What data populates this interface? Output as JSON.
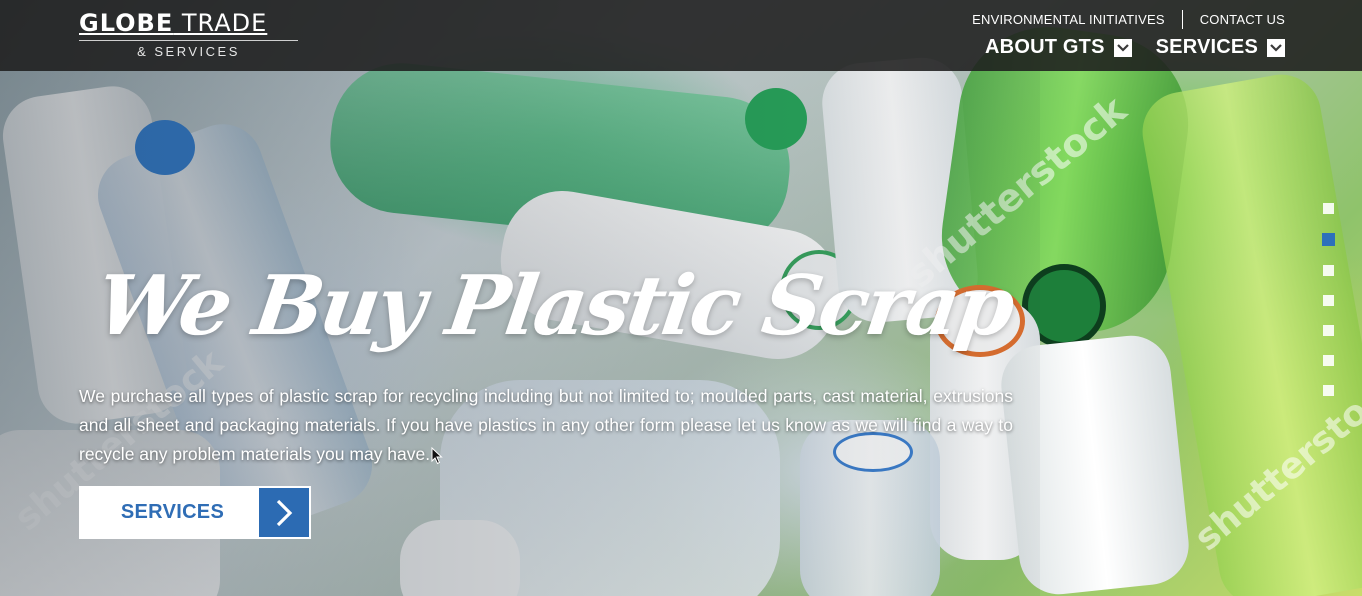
{
  "header": {
    "logo": {
      "main_bold": "GLOBE",
      "main_rest": " TRADE",
      "sub": "& SERVICES"
    },
    "utility_links": [
      "ENVIRONMENTAL INITIATIVES",
      "CONTACT US"
    ],
    "main_nav": [
      {
        "label": "ABOUT GTS",
        "icon": "chevron-down-icon"
      },
      {
        "label": "SERVICES",
        "icon": "chevron-down-icon"
      }
    ]
  },
  "hero": {
    "headline": "We Buy Plastic Scrap",
    "intro": "We purchase all types of plastic scrap for recycling including but not limited to; moulded parts, cast material, extrusions and all sheet and packaging materials. If you have plastics in any other form please let us know as we will find a way to recycle any problem materials you may have.",
    "cta_label": "SERVICES",
    "cta_icon": "chevron-right-icon",
    "watermarks": [
      "shutterstock",
      "shutterstock",
      "shutterstock"
    ]
  },
  "slider": {
    "total": 7,
    "active_index": 1
  },
  "colors": {
    "accent_blue": "#2c6bb3",
    "header_bg": "#1e1e1e",
    "cta_text": "#2f6db5",
    "caret_icon": "#3a3a3a"
  }
}
